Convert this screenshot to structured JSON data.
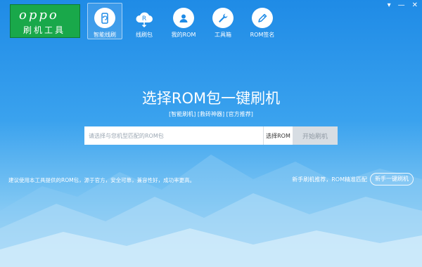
{
  "logo": {
    "brand": "oppo",
    "subtitle": "刷机工具"
  },
  "nav": {
    "items": [
      {
        "label": "智能线刷",
        "icon": "phone-refresh-icon",
        "active": true
      },
      {
        "label": "线刷包",
        "icon": "rom-cloud-download-icon",
        "active": false
      },
      {
        "label": "我的ROM",
        "icon": "user-icon",
        "active": false
      },
      {
        "label": "工具箱",
        "icon": "wrench-icon",
        "active": false
      },
      {
        "label": "ROM签名",
        "icon": "pen-icon",
        "active": false
      }
    ]
  },
  "window_controls": {
    "menu": "▾",
    "minimize": "—",
    "close": "✕"
  },
  "main": {
    "headline": "选择ROM包一键刷机",
    "subline": "[智能刷机] [救砖神器] [官方推荐]",
    "search": {
      "placeholder": "请选择与您机型匹配的ROM包",
      "value": ""
    },
    "select_rom_label": "选择ROM",
    "start_label": "开始刷机"
  },
  "footer": {
    "left_text": "建议使用本工具提供的ROM包，源于官方，安全可靠，兼容性好，成功率更高。",
    "right_text": "新手刷机推荐，ROM精准匹配",
    "novice_label": "新手一键刷机"
  },
  "colors": {
    "logo_green": "#19a84a",
    "sky_top": "#1f8be6",
    "sky_bottom": "#b9e0f8",
    "start_disabled": "#d7dde3"
  }
}
